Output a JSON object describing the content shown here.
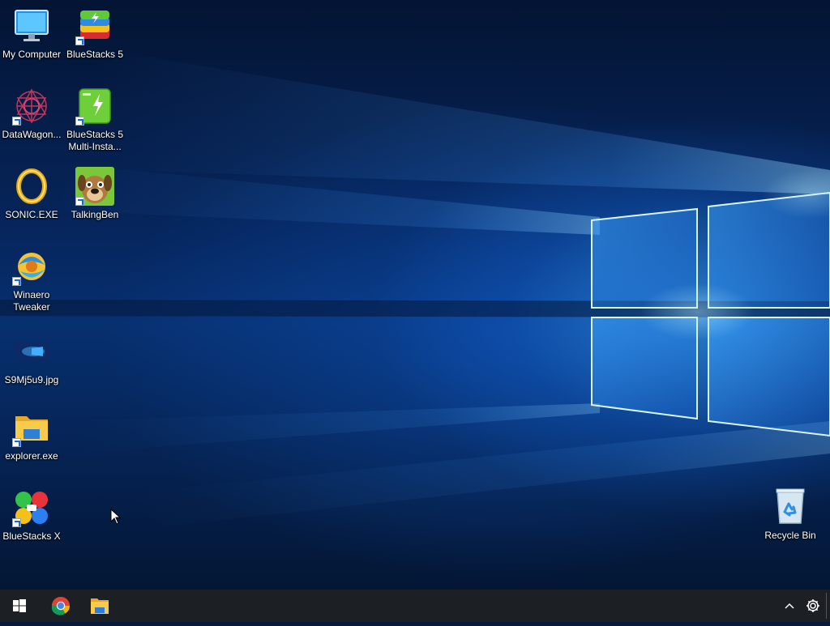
{
  "desktop": {
    "icons": [
      {
        "label": "My Computer",
        "icon": "computer-icon"
      },
      {
        "label": "BlueStacks 5",
        "icon": "bluestacks-icon"
      },
      {
        "label": "DataWagon...",
        "icon": "datawagon-icon"
      },
      {
        "label": "BlueStacks 5 Multi-Insta...",
        "icon": "bluestacks-multi-instance-icon"
      },
      {
        "label": "SONIC.EXE",
        "icon": "sonic-ring-icon"
      },
      {
        "label": "TalkingBen",
        "icon": "talkingben-icon"
      },
      {
        "label": "Winaero Tweaker",
        "icon": "winaero-tweaker-icon"
      },
      {
        "label": "S9Mj5u9.jpg",
        "icon": "image-file-icon"
      },
      {
        "label": "explorer.exe",
        "icon": "folder-icon"
      },
      {
        "label": "BlueStacks X",
        "icon": "bluestacks-x-icon"
      },
      {
        "label": "Recycle Bin",
        "icon": "recycle-bin-icon"
      }
    ]
  },
  "taskbar": {
    "start": "windows-logo-icon",
    "pinned": [
      "chrome-icon",
      "file-explorer-icon"
    ],
    "tray": [
      "chevron-up-icon",
      "gear-icon"
    ]
  },
  "colors": {
    "taskbar": "#1c2025",
    "wallpaper_accent": "#3aa0ff"
  }
}
